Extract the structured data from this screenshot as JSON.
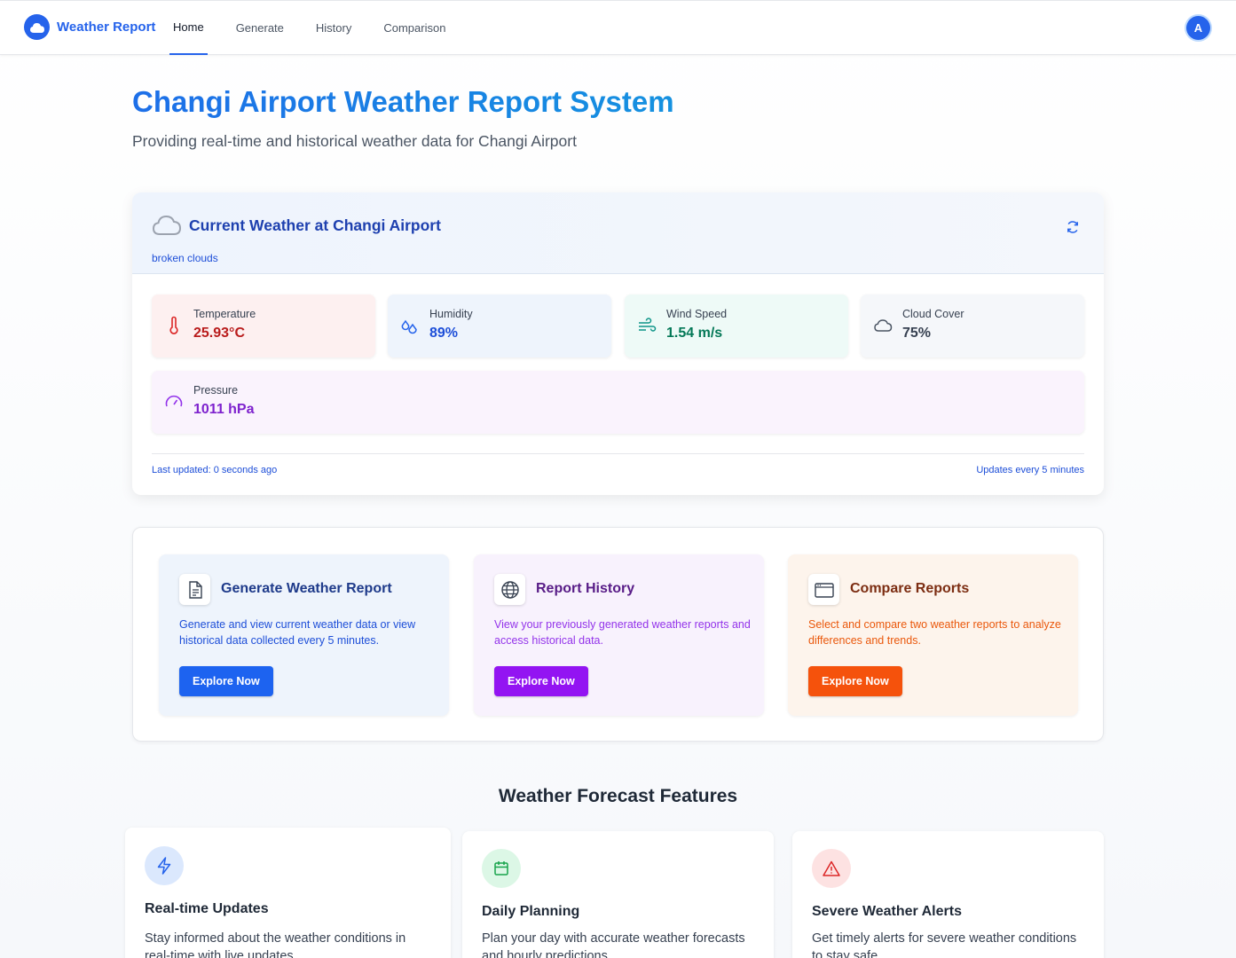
{
  "nav": {
    "brand": "Weather Report",
    "links": [
      "Home",
      "Generate",
      "History",
      "Comparison"
    ],
    "avatar_initial": "A"
  },
  "hero": {
    "title": "Changi Airport Weather Report System",
    "subtitle": "Providing real-time and historical weather data for Changi Airport"
  },
  "current_weather": {
    "title": "Current Weather at Changi Airport",
    "description": "broken clouds",
    "stats": {
      "temperature": {
        "label": "Temperature",
        "value": "25.93°C",
        "icon": "thermometer-icon"
      },
      "humidity": {
        "label": "Humidity",
        "value": "89%",
        "icon": "droplets-icon"
      },
      "wind": {
        "label": "Wind Speed",
        "value": "1.54 m/s",
        "icon": "wind-icon"
      },
      "cloud": {
        "label": "Cloud Cover",
        "value": "75%",
        "icon": "cloud-icon"
      },
      "pressure": {
        "label": "Pressure",
        "value": "1011 hPa",
        "icon": "gauge-icon"
      }
    },
    "last_updated": "Last updated: 0 seconds ago",
    "interval": "Updates every 5 minutes"
  },
  "actions": [
    {
      "title": "Generate Weather Report",
      "description": "Generate and view current weather data or view historical data collected every 5 minutes.",
      "button": "Explore Now",
      "icon": "document-icon",
      "accent": "#1d63f0"
    },
    {
      "title": "Report History",
      "description": "View your previously generated weather reports and access historical data.",
      "button": "Explore Now",
      "icon": "globe-icon",
      "accent": "#9314f2"
    },
    {
      "title": "Compare Reports",
      "description": "Select and compare two weather reports to analyze differences and trends.",
      "button": "Explore Now",
      "icon": "window-icon",
      "accent": "#f5520c"
    }
  ],
  "features": {
    "heading": "Weather Forecast Features",
    "items": [
      {
        "title": "Real-time Updates",
        "description": "Stay informed about the weather conditions in real-time with live updates.",
        "icon": "lightning-icon"
      },
      {
        "title": "Daily Planning",
        "description": "Plan your day with accurate weather forecasts and hourly predictions.",
        "icon": "calendar-icon"
      },
      {
        "title": "Severe Weather Alerts",
        "description": "Get timely alerts for severe weather conditions to stay safe.",
        "icon": "alert-triangle-icon"
      }
    ]
  }
}
